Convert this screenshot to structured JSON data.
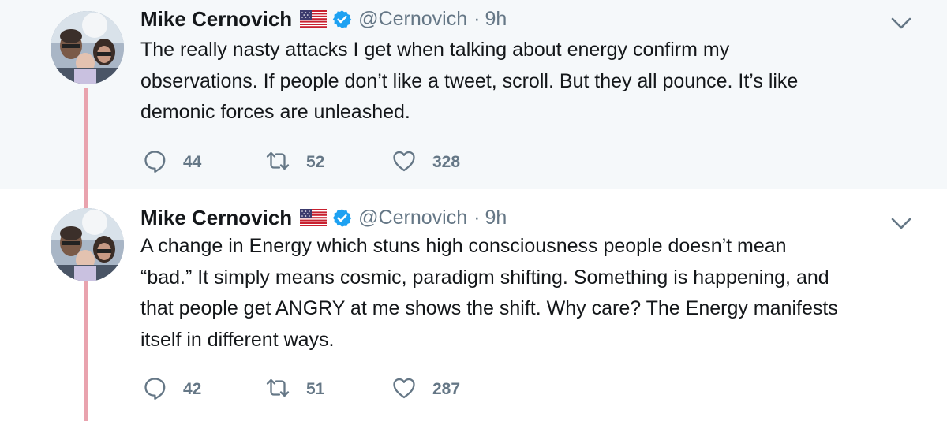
{
  "tweets": [
    {
      "name": "Mike Cernovich",
      "handle": "@Cernovich",
      "separator": "·",
      "time": "9h",
      "text": "The really nasty attacks I get when talking about energy confirm my\nobservations. If people don’t like a tweet, scroll. But they all pounce. It’s like\ndemonic forces are unleashed.",
      "replies": "44",
      "retweets": "52",
      "likes": "328"
    },
    {
      "name": "Mike Cernovich",
      "handle": "@Cernovich",
      "separator": "·",
      "time": "9h",
      "text": "A change in Energy which stuns high consciousness people doesn’t mean\n“bad.” It simply means cosmic, paradigm shifting. Something is happening, and\nthat people get ANGRY at me shows the shift. Why care? The Energy manifests\nitself in different ways.",
      "replies": "42",
      "retweets": "51",
      "likes": "287"
    }
  ],
  "icons": {
    "name_emoji": "us-flag-icon",
    "verified": "verified-badge-icon",
    "menu": "chevron-down-icon",
    "reply": "reply-icon",
    "retweet": "retweet-icon",
    "like": "heart-icon"
  },
  "colors": {
    "text": "#14171a",
    "secondary": "#657786",
    "verified": "#1da1f2",
    "thread_line": "#e9a3ae",
    "highlight_bg": "#f5f8fa"
  }
}
